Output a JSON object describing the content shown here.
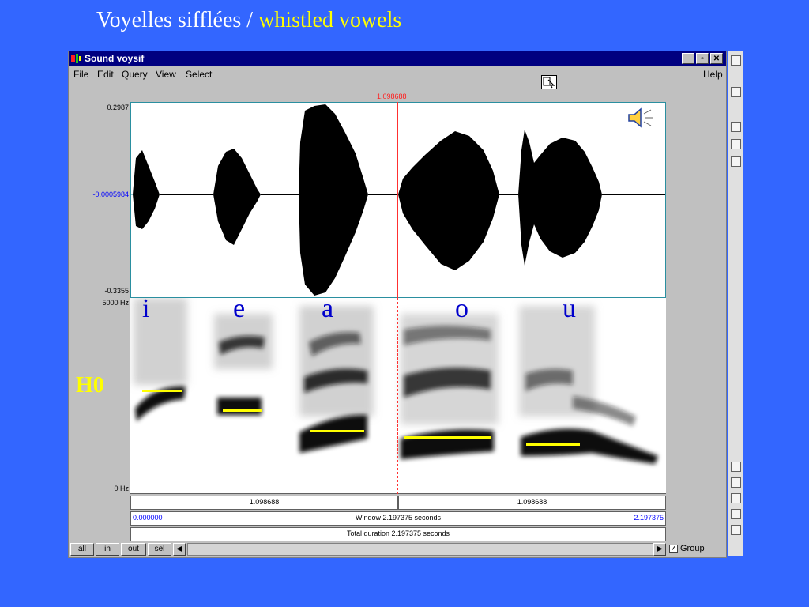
{
  "slide": {
    "title_fr": "Voyelles sifflées",
    "separator": " / ",
    "title_en": "whistled vowels"
  },
  "window": {
    "title": "Sound voysif",
    "controls": [
      "_",
      "▫",
      "✕"
    ],
    "menu": [
      "File",
      "Edit",
      "Query",
      "View",
      "Select"
    ],
    "help": "Help"
  },
  "cursor_time": "1.098688",
  "waveform": {
    "y_max": "0.2987",
    "y_mid": "-0.0005984",
    "y_min": "-0.3355"
  },
  "spectrogram": {
    "f_max": "5000 Hz",
    "f_min": "0 Hz"
  },
  "vowels": [
    "i",
    "e",
    "a",
    "o",
    "u"
  ],
  "h0_label": "H0",
  "info_bars": {
    "left_segment": "1.098688",
    "right_segment": "1.098688",
    "start_time": "0.000000",
    "window": "Window 2.197375 seconds",
    "end_time": "2.197375",
    "total": "Total duration 2.197375 seconds"
  },
  "bottom": {
    "buttons": [
      "all",
      "in",
      "out",
      "sel"
    ],
    "group_label": "Group",
    "group_checked": true
  },
  "colors": {
    "background": "#3366ff",
    "title_white": "#ffffff",
    "title_yellow": "#ffff00",
    "cursor": "#ff3030",
    "h0_line": "#ffff00",
    "vowel_label": "#0000cc"
  }
}
